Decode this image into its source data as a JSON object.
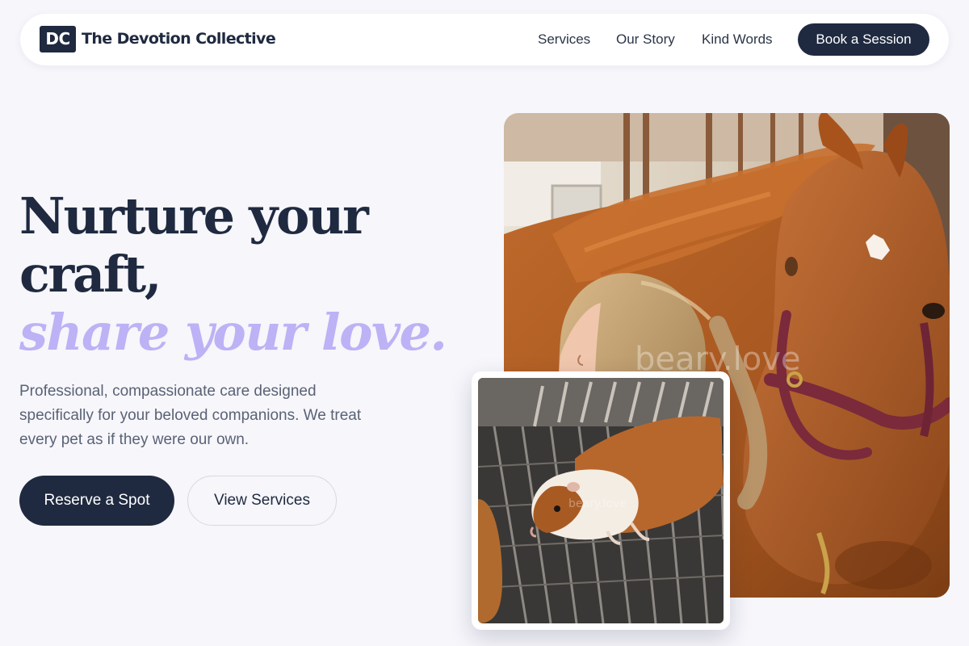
{
  "nav": {
    "logo_mark": "DC",
    "brand": "The Devotion Collective",
    "links": [
      "Services",
      "Our Story",
      "Kind Words"
    ],
    "cta": "Book a Session"
  },
  "hero": {
    "headline_line1": "Nurture your",
    "headline_line2": "craft,",
    "headline_accent": "share your love.",
    "lede": "Professional, compassionate care designed specifically for your beloved companions. We treat every pet as if they were our own.",
    "primary_button": "Reserve a Spot",
    "secondary_button": "View Services"
  },
  "images": {
    "main_photo": "woman-with-chestnut-horse-photo",
    "small_photo": "guinea-pig-on-wire-grid-photo",
    "watermark": "beary.love"
  },
  "colors": {
    "background": "#f6f6fb",
    "navy": "#1f2a40",
    "accent_lavender": "#bcb2f5",
    "body_text": "#5a6275"
  }
}
